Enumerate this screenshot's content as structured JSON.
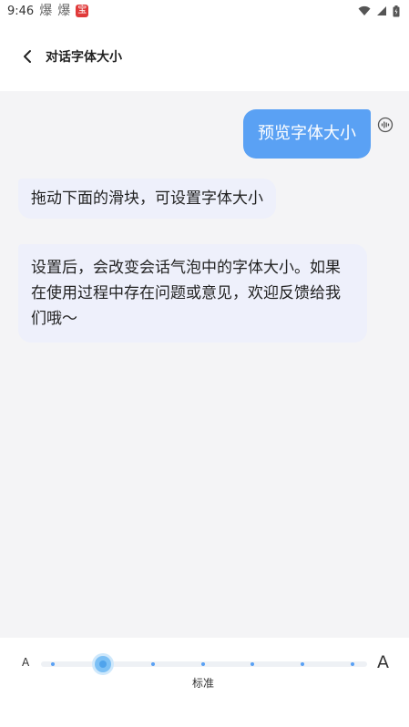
{
  "status_bar": {
    "time": "9:46",
    "notif_1": "爆",
    "notif_2": "爆",
    "notif_3": "宝"
  },
  "header": {
    "title": "对话字体大小"
  },
  "chat": {
    "preview_bubble": "预览字体大小",
    "message_1": "拖动下面的滑块，可设置字体大小",
    "message_2": "设置后，会改变会话气泡中的字体大小。如果在使用过程中存在问题或意见，欢迎反馈给我们哦～"
  },
  "slider": {
    "min_label": "A",
    "max_label": "A",
    "current_label": "标准",
    "step_count": 7,
    "selected_step": 2
  },
  "colors": {
    "accent": "#5aa1f4",
    "chat_bg": "#f4f4f6",
    "bubble_left_bg": "#eef0fb"
  }
}
